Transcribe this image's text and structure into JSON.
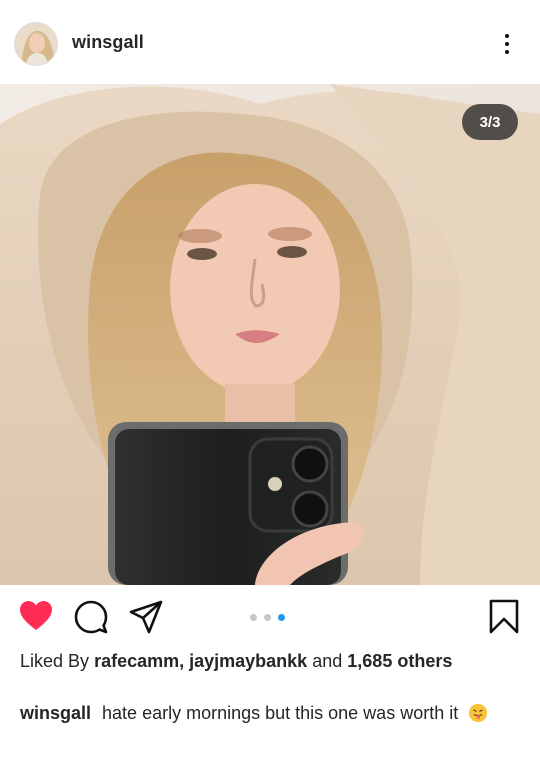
{
  "post": {
    "username": "winsgall",
    "image_counter": "3/3",
    "carousel": {
      "count": 3,
      "active": 3
    }
  },
  "likes": {
    "prefix": "Liked By",
    "users": "rafecamm, jayjmaybankk",
    "and": "and",
    "count": "1,685",
    "suffix": "others"
  },
  "caption": {
    "username": "winsgall",
    "text": "hate early mornings but this one was worth it"
  },
  "icons": {
    "avatar": "profile-avatar",
    "more": "more-options-icon",
    "like": "heart-icon",
    "comment": "comment-icon",
    "share": "send-icon",
    "save": "bookmark-icon",
    "emoji": "tongue-out-emoji"
  },
  "colors": {
    "like_active": "#ff2d55",
    "carousel_active": "#1e9bf0",
    "carousel_inactive": "#c7c7c7"
  }
}
